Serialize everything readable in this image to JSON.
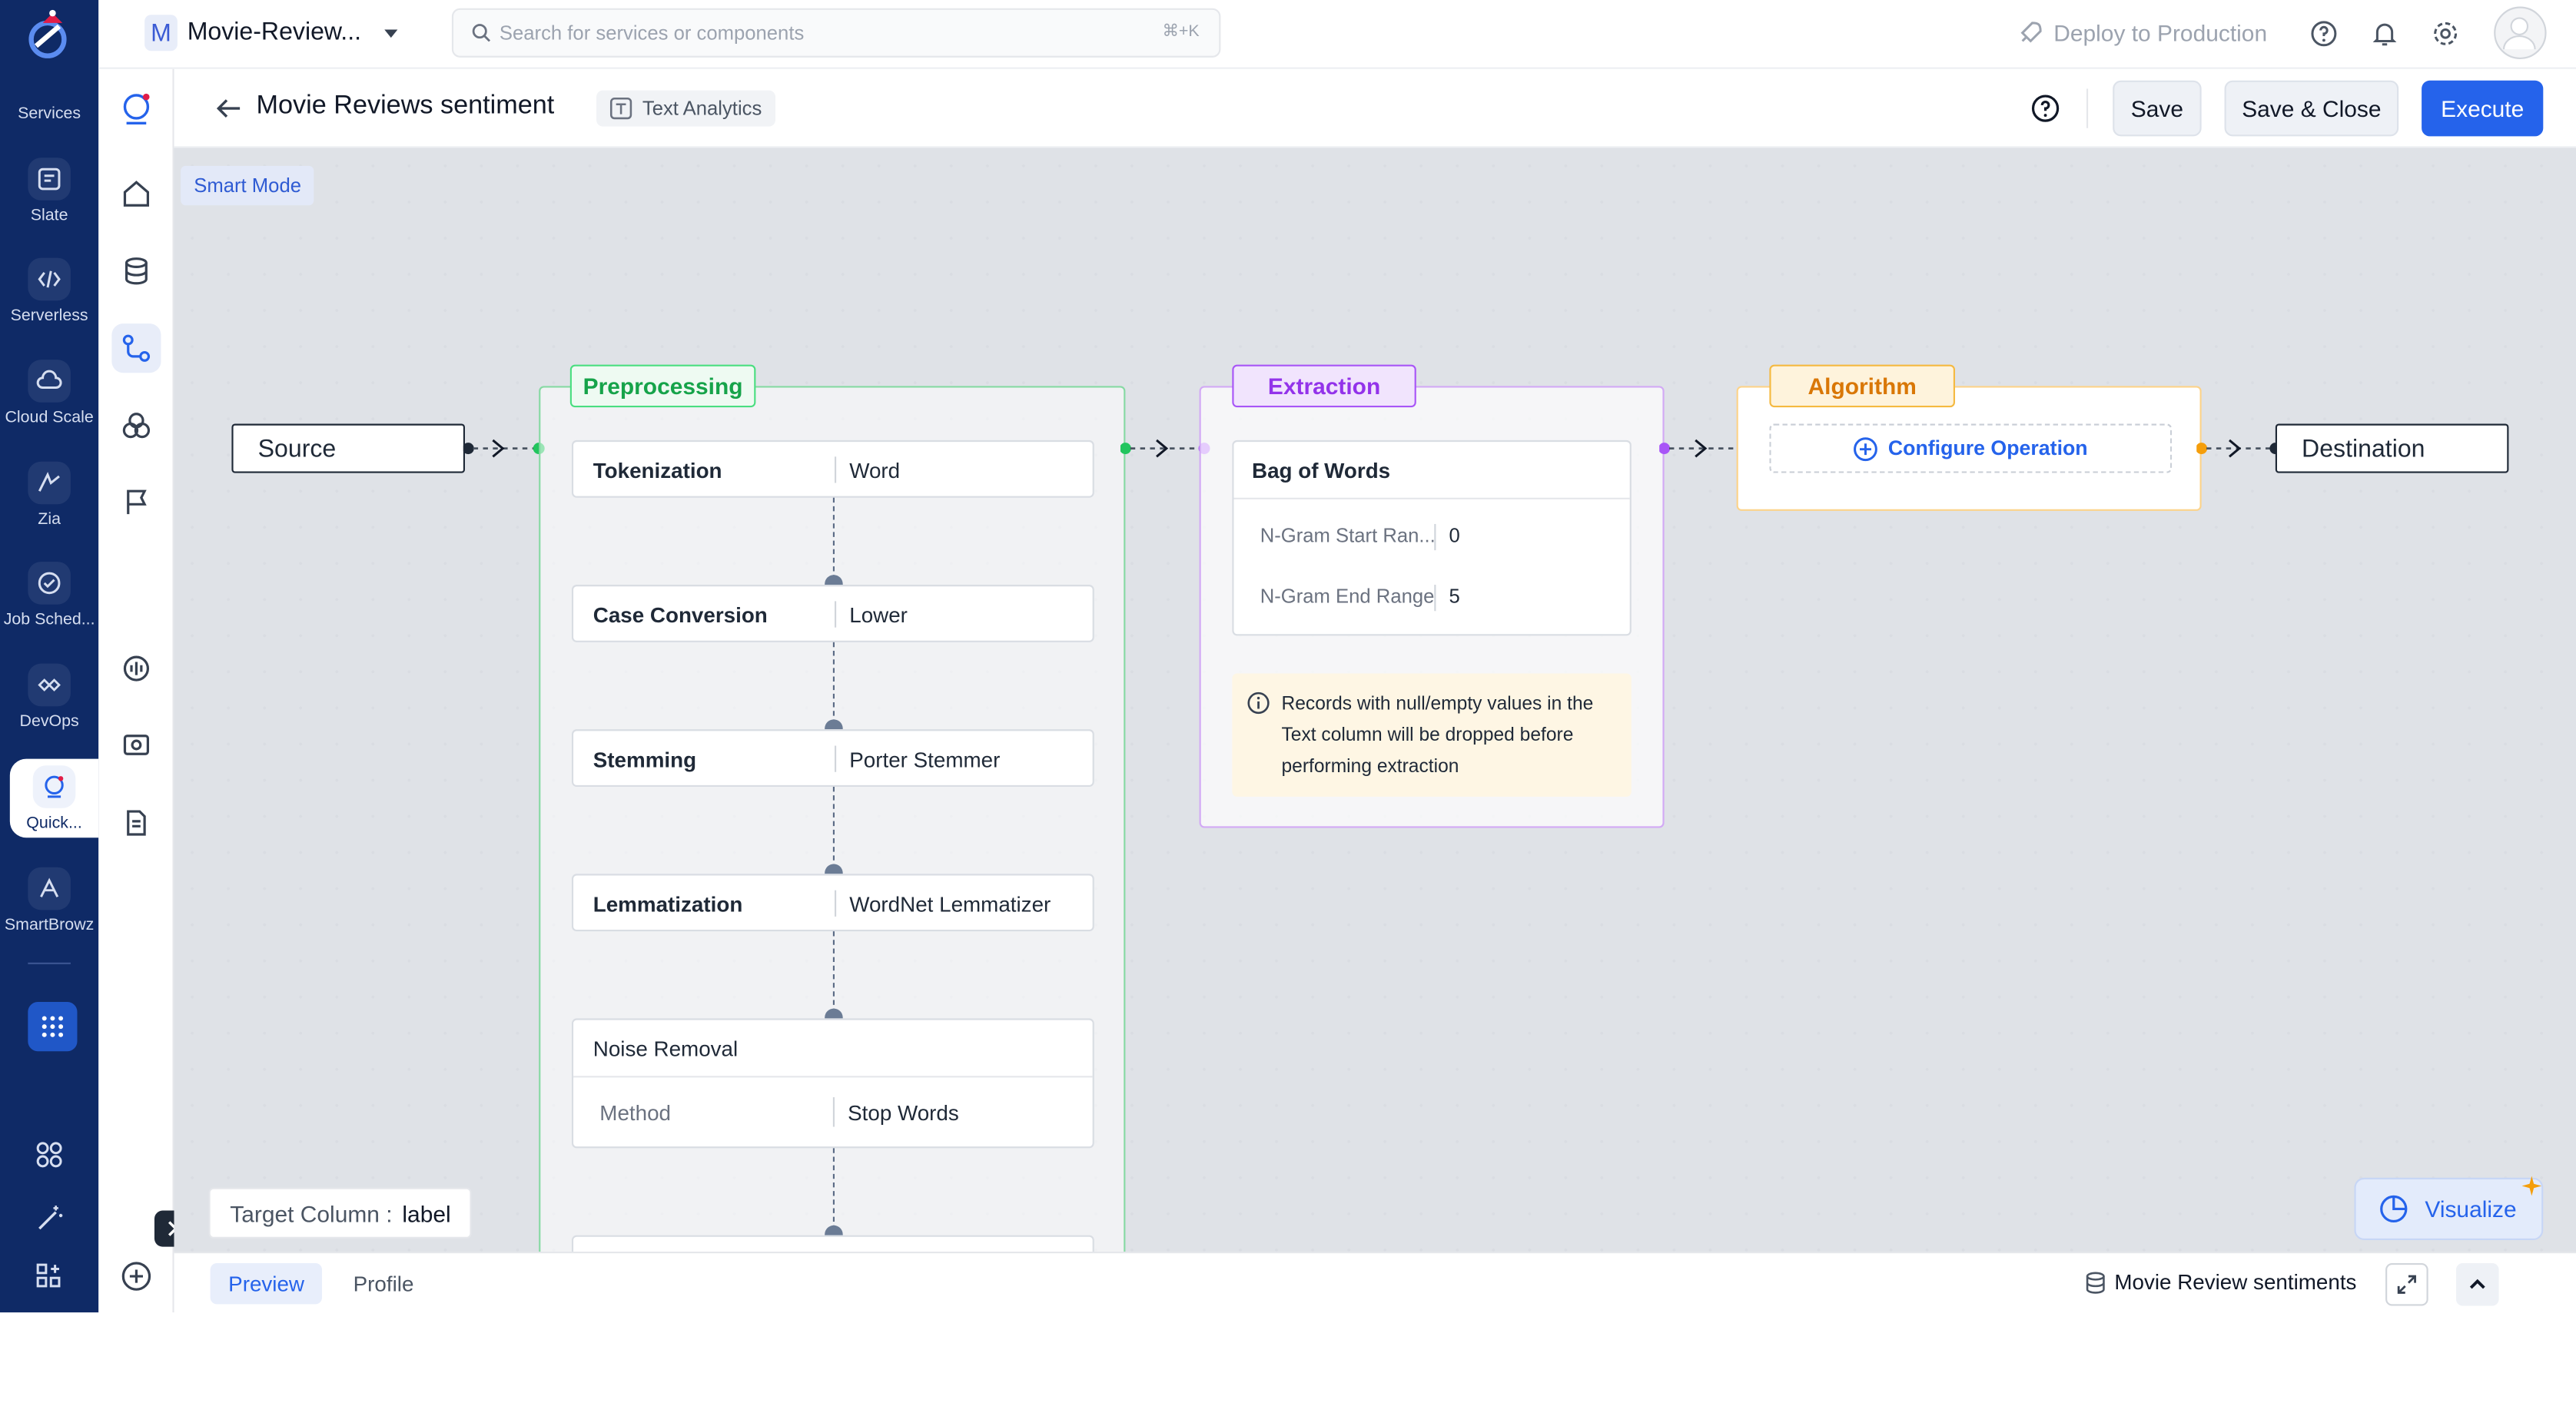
{
  "topbar": {
    "project_badge": "M",
    "project_name": "Movie-Review...",
    "search_placeholder": "Search for services or components",
    "search_shortcut": "⌘+K",
    "deploy_label": "Deploy to Production"
  },
  "rail": {
    "section_label": "Services",
    "items": [
      {
        "label": "Slate",
        "icon": "slate-icon"
      },
      {
        "label": "Serverless",
        "icon": "serverless-icon"
      },
      {
        "label": "Cloud Scale",
        "icon": "cloud-scale-icon"
      },
      {
        "label": "Zia",
        "icon": "zia-icon"
      },
      {
        "label": "Job Sched...",
        "icon": "job-scheduler-icon"
      },
      {
        "label": "DevOps",
        "icon": "devops-icon"
      },
      {
        "label": "Quick...",
        "icon": "quickml-icon",
        "active": true
      },
      {
        "label": "SmartBrowz",
        "icon": "smartbrowz-icon"
      }
    ]
  },
  "header": {
    "title": "Movie Reviews sentiment",
    "tag": "Text Analytics",
    "save_label": "Save",
    "save_close_label": "Save & Close",
    "execute_label": "Execute"
  },
  "canvas": {
    "smart_mode_label": "Smart Mode",
    "source_label": "Source",
    "destination_label": "Destination",
    "preprocessing": {
      "title": "Preprocessing",
      "ops": [
        {
          "name": "Tokenization",
          "value": "Word"
        },
        {
          "name": "Case Conversion",
          "value": "Lower"
        },
        {
          "name": "Stemming",
          "value": "Porter Stemmer"
        },
        {
          "name": "Lemmatization",
          "value": "WordNet Lemmatizer"
        }
      ],
      "noise": {
        "name": "Noise Removal",
        "param_label": "Method",
        "param_value": "Stop Words"
      }
    },
    "extraction": {
      "title": "Extraction",
      "method": "Bag of Words",
      "params": [
        {
          "label": "N-Gram Start Ran...",
          "value": "0"
        },
        {
          "label": "N-Gram End Range",
          "value": "5"
        }
      ],
      "notice": "Records with null/empty values in the Text column will be dropped before performing extraction"
    },
    "algorithm": {
      "title": "Algorithm",
      "configure_label": "Configure Operation"
    },
    "target_column_label": "Target Column :",
    "target_column_value": "label",
    "visualize_label": "Visualize"
  },
  "footer": {
    "tabs": [
      "Preview",
      "Profile"
    ],
    "dataset_name": "Movie Review sentiments"
  },
  "colors": {
    "rail_bg": "#0f2a66",
    "primary": "#2563eb",
    "preprocessing": "#22c55e",
    "extraction": "#a855f7",
    "algorithm": "#f59e0b"
  }
}
